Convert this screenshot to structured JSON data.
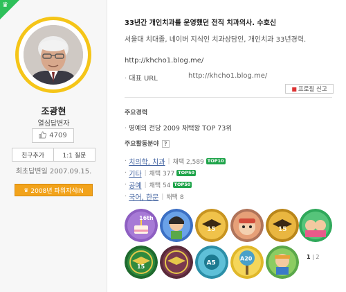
{
  "profile": {
    "name": "조광현",
    "role": "열심답변자",
    "likes": "4709",
    "buttons": {
      "add_friend": "친구추가",
      "question": "1:1 질문"
    },
    "first_answer_date": "최초답변일 2007.09.15.",
    "power_badge": "2008년 파워지식iN"
  },
  "intro": {
    "headline": "33년간 개인치과를 운영했던 전직 치과의사. 수호신",
    "subline": "서울대 치대졸, 네이버 지식인 치과상담인, 개인치과 33년경력.",
    "url": "http://khcho1.blog.me/",
    "rep_url_label": "대표 URL",
    "rep_url": "http://khcho1.blog.me/",
    "report_label": "프로필 신고"
  },
  "career": {
    "title": "주요경력",
    "items": [
      "명예의 전당 2009 채택왕 TOP 73위"
    ]
  },
  "fields": {
    "title": "주요활동분야",
    "help": "?",
    "items": [
      {
        "name": "치의학, 치과",
        "count": "채택 2,589",
        "badge": "TOP10"
      },
      {
        "name": "기타",
        "count": "채택 377",
        "badge": "TOP50"
      },
      {
        "name": "공예",
        "count": "채택 54",
        "badge": "TOP50"
      },
      {
        "name": "국어, 한문",
        "count": "채택 8",
        "badge": ""
      }
    ]
  },
  "badge_labels": {
    "b1": "16th",
    "b7": "15",
    "b9": "A5",
    "b10": "A20"
  },
  "pager": {
    "current": "1",
    "sep": "|",
    "total": "2"
  },
  "colors": {
    "accent_green": "#2ec05a",
    "gold": "#f5c518",
    "power_orange": "#f2a31b",
    "link_blue": "#3d5f9e",
    "top_green": "#1fa44a"
  }
}
